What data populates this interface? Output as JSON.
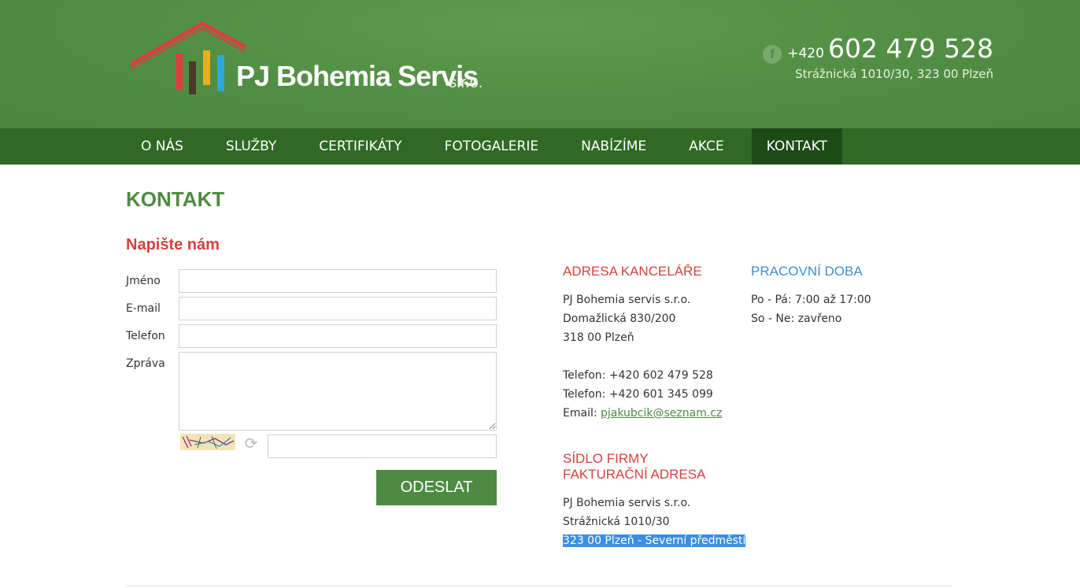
{
  "header": {
    "brand_name": "PJ Bohemia Servis",
    "brand_suffix": "s.r.o.",
    "phone_prefix": "+420",
    "phone_number": "602 479 528",
    "address": "Strážnická 1010/30, 323 00 Plzeň",
    "facebook_icon": "facebook-icon"
  },
  "colors": {
    "brand_green": "#4e8b42",
    "nav_green": "#2f6924",
    "nav_active": "#1e4a18",
    "accent_red": "#d8403d",
    "accent_blue": "#3d8fd6"
  },
  "nav": {
    "items": [
      {
        "label": "O NÁS"
      },
      {
        "label": "SLUŽBY"
      },
      {
        "label": "CERTIFIKÁTY"
      },
      {
        "label": "FOTOGALERIE"
      },
      {
        "label": "NABÍZÍME"
      },
      {
        "label": "AKCE"
      },
      {
        "label": "KONTAKT",
        "active": true
      }
    ]
  },
  "main": {
    "page_title": "KONTAKT",
    "form": {
      "title": "Napište nám",
      "name_label": "Jméno",
      "name_value": "",
      "email_label": "E-mail",
      "email_value": "",
      "phone_label": "Telefon",
      "phone_value": "",
      "message_label": "Zpráva",
      "message_value": "",
      "captcha_value": "",
      "submit_label": "ODESLAT"
    },
    "office": {
      "heading": "ADRESA KANCELÁŘE",
      "line1": "PJ Bohemia servis s.r.o.",
      "line2": "Domažlická 830/200",
      "line3": "318 00 Plzeň",
      "phone1": "Telefon: +420 602 479 528",
      "phone2": "Telefon: +420 601 345 099",
      "email_label": "Email: ",
      "email": "pjakubcik@seznam.cz"
    },
    "hours": {
      "heading": "PRACOVNÍ DOBA",
      "line1": "Po - Pá: 7:00 až 17:00",
      "line2": "So - Ne: zavřeno"
    },
    "seat": {
      "heading1": "SÍDLO FIRMY",
      "heading2": "FAKTURAČNÍ ADRESA",
      "line1": "PJ Bohemia servis s.r.o.",
      "line2": "Strážnická 1010/30",
      "line3": "323 00 Plzeň - Severní předměstí"
    }
  }
}
